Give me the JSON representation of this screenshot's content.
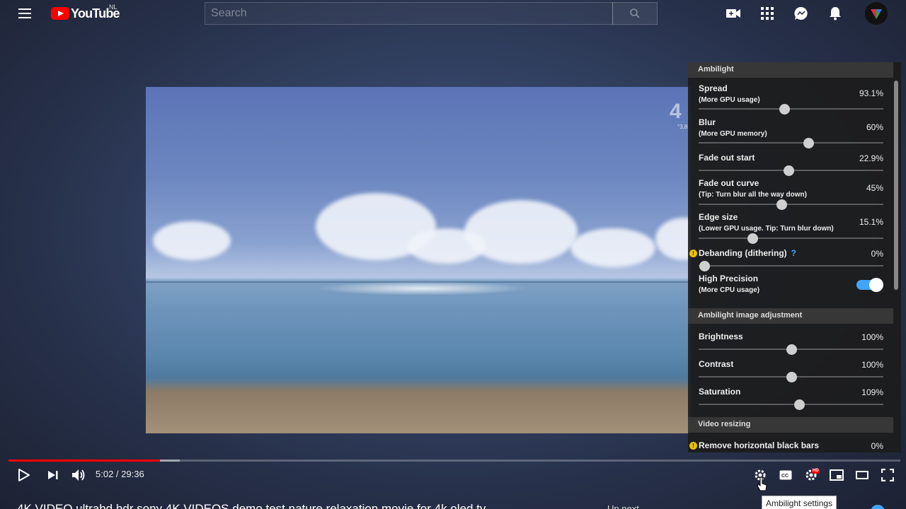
{
  "masthead": {
    "logo_text": "YouTube",
    "country_code": "NL",
    "search_placeholder": "Search",
    "icons": [
      "menu-icon",
      "search-icon",
      "create-video-icon",
      "apps-grid-icon",
      "messages-icon",
      "notifications-bell-icon",
      "avatar"
    ]
  },
  "video": {
    "watermark": "4",
    "watermark_sub": "°3,8"
  },
  "panel": {
    "sections": [
      {
        "header": "Ambilight",
        "options": [
          {
            "label": "Spread",
            "sub": "(More GPU usage)",
            "value": "93.1%",
            "level": 0.465
          },
          {
            "label": "Blur",
            "sub": "(More GPU memory)",
            "value": "60%",
            "level": 0.595
          },
          {
            "label": "Fade out start",
            "sub": "",
            "value": "22.9%",
            "level": 0.485
          },
          {
            "label": "Fade out curve",
            "sub": "(Tip: Turn blur all the way down)",
            "value": "45%",
            "level": 0.45
          },
          {
            "label": "Edge size",
            "sub": "(Lower GPU usage. Tip: Turn blur down)",
            "value": "15.1%",
            "level": 0.29
          },
          {
            "label": "Debanding (dithering)",
            "sub": "",
            "value": "0%",
            "level": 0.03,
            "warning": true,
            "help": "?"
          },
          {
            "label": "High Precision",
            "sub": "(More CPU usage)",
            "toggle": true,
            "enabled": true
          }
        ]
      },
      {
        "header": "Ambilight image adjustment",
        "options": [
          {
            "label": "Brightness",
            "value": "100%",
            "level": 0.5
          },
          {
            "label": "Contrast",
            "value": "100%",
            "level": 0.5
          },
          {
            "label": "Saturation",
            "value": "109%",
            "level": 0.545
          }
        ]
      },
      {
        "header": "Video resizing",
        "options": [
          {
            "label": "Remove horizontal black bars",
            "value": "0%",
            "warning": true
          }
        ]
      }
    ]
  },
  "player": {
    "time_display": "5:02 / 29:36",
    "progress_played": 0.17,
    "progress_buffered": 0.192,
    "ambilight_badge": "",
    "hd_badge": "HD",
    "tooltip": "Ambilight settings"
  },
  "below": {
    "video_title": "4K VIDEO ultrahd hdr sony 4K VIDEOS demo test nature relaxation movie for 4k oled tv",
    "side_snippet": "Up next"
  }
}
